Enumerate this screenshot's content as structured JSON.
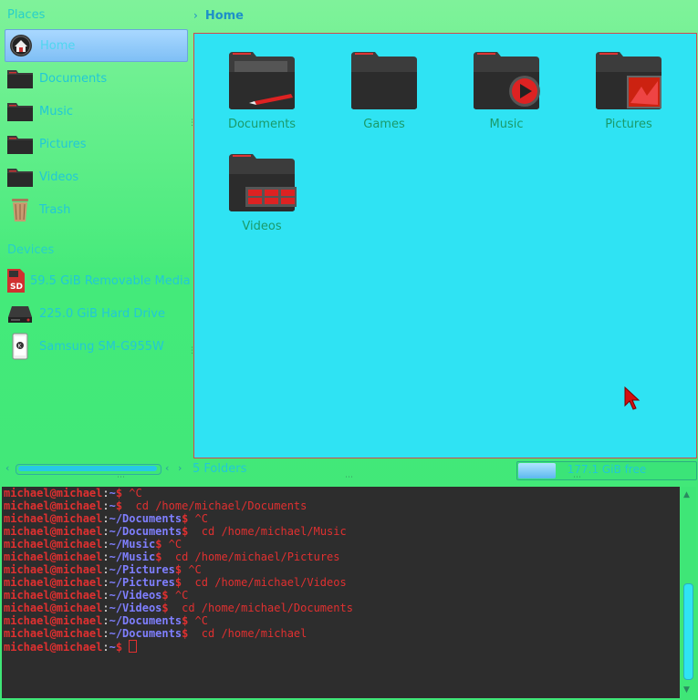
{
  "sidebar": {
    "places_title": "Places",
    "places": [
      {
        "label": "Home",
        "icon": "home-icon",
        "selected": true
      },
      {
        "label": "Documents",
        "icon": "folder-icon"
      },
      {
        "label": "Music",
        "icon": "folder-icon"
      },
      {
        "label": "Pictures",
        "icon": "folder-icon"
      },
      {
        "label": "Videos",
        "icon": "folder-icon"
      },
      {
        "label": "Trash",
        "icon": "trash-icon"
      }
    ],
    "devices_title": "Devices",
    "devices": [
      {
        "label": "59.5 GiB Removable Media",
        "icon": "sd-card-icon"
      },
      {
        "label": "225.0 GiB Hard Drive",
        "icon": "hard-drive-icon"
      },
      {
        "label": "Samsung SM-G955W",
        "icon": "phone-icon"
      }
    ]
  },
  "breadcrumb": {
    "current": "Home"
  },
  "files": [
    {
      "name": "Documents",
      "emblem": "pen"
    },
    {
      "name": "Games",
      "emblem": "none"
    },
    {
      "name": "Music",
      "emblem": "play"
    },
    {
      "name": "Pictures",
      "emblem": "picture"
    },
    {
      "name": "Videos",
      "emblem": "film"
    }
  ],
  "status": {
    "folders": "5 Folders",
    "free_space": "177.1 GiB free",
    "used_fraction": 0.21
  },
  "terminal": {
    "user_host": "michael@michael",
    "lines": [
      {
        "path": "~",
        "cmd": " ^C"
      },
      {
        "path": "~",
        "cmd": "  cd /home/michael/Documents"
      },
      {
        "path": "~/Documents",
        "cmd": " ^C"
      },
      {
        "path": "~/Documents",
        "cmd": "  cd /home/michael/Music"
      },
      {
        "path": "~/Music",
        "cmd": " ^C"
      },
      {
        "path": "~/Music",
        "cmd": "  cd /home/michael/Pictures"
      },
      {
        "path": "~/Pictures",
        "cmd": " ^C"
      },
      {
        "path": "~/Pictures",
        "cmd": "  cd /home/michael/Videos"
      },
      {
        "path": "~/Videos",
        "cmd": " ^C"
      },
      {
        "path": "~/Videos",
        "cmd": "  cd /home/michael/Documents"
      },
      {
        "path": "~/Documents",
        "cmd": " ^C"
      },
      {
        "path": "~/Documents",
        "cmd": "  cd /home/michael"
      },
      {
        "path": "~",
        "cmd": " ",
        "cursor": true
      }
    ]
  },
  "colors": {
    "window_bg": "#44ea7a",
    "view_bg": "#2fe3f3",
    "accent_text": "#22c8d6",
    "terminal_bg": "#2d2d2d",
    "terminal_text": "#e03030",
    "terminal_path": "#7f7fff"
  }
}
